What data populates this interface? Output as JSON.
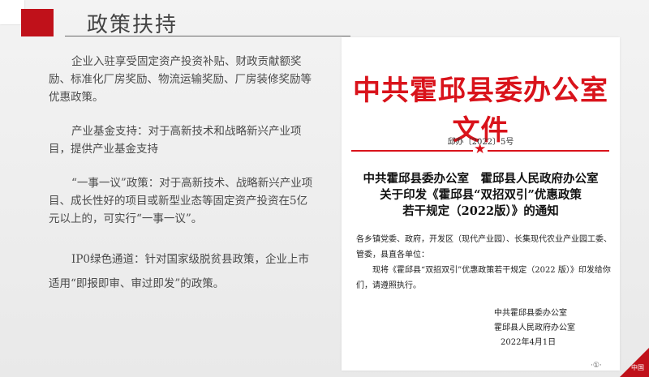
{
  "title": "政策扶持",
  "left_paragraphs": [
    "企业入驻享受固定资产投资补贴、财政贡献额奖励、标准化厂房奖励、物流运输奖励、厂房装修奖励等优惠政策。",
    "产业基金支持：对于高新技术和战略新兴产业项目，提供产业基金支持",
    "“一事一议”政策：对于高新技术、战略新兴产业项目、成长性好的项目或新型业态等固定资产投资在5亿元以上的，可实行“一事一议”。",
    "IP0绿色通道：针对国家级脱贫县政策，企业上市适用“即报即审、审过即发”的政策。"
  ],
  "document": {
    "header": "中共霍邱县委办公室文件",
    "number": "邱办〔2022〕5号",
    "title_lines": [
      "中共霍邱县委办公室　霍邱县人民政府办公室",
      "关于印发《霍邱县“双招双引”优惠政策",
      "若干规定（2022版）》的通知"
    ],
    "body_lines": [
      "各乡镇党委、政府，开发区（现代产业园）、长集现代农业产业园工委、管委，县直各单位：",
      "现将《霍邱县“双招双引”优惠政策若干规定（2022 版）》印发给你们，请遵照执行。"
    ],
    "signature_lines": [
      "中共霍邱县委办公室",
      "霍邱县人民政府办公室",
      "2022年4月1日"
    ]
  },
  "footer_mark": "·①·",
  "logo_text": "中国"
}
